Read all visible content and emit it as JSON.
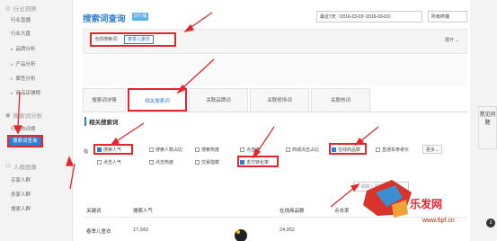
{
  "sidebar": {
    "sections": [
      {
        "label": "行业洞察",
        "items": [
          "行业直播",
          "行业大盘",
          "品牌分析",
          "产品分析",
          "属性分析",
          "商品店铺榜"
        ]
      },
      {
        "label": "搜索词分析",
        "items": [
          "行业热词榜",
          "搜索词查询"
        ]
      },
      {
        "label": "人群画像",
        "items": [
          "买家人群",
          "卖家人群",
          "搜索人群"
        ]
      }
    ]
  },
  "header": {
    "title": "搜索词查询",
    "badge": "日行版",
    "date_range": "最近7天（2016-03-03~2016-03-03）",
    "terminal": "所有终端"
  },
  "keyword": {
    "label": "当前搜索词：",
    "value": "春季儿童衣",
    "expand": "展开"
  },
  "tabs": [
    "搜索词详情",
    "相关搜索词",
    "关联品牌词",
    "关联修饰词",
    "关联热词"
  ],
  "section_title": "相关搜索词",
  "options": {
    "row1": [
      "搜索人气",
      "搜索人数占比",
      "搜索热度",
      "点击率",
      "商城点击占比",
      "在线商品数",
      "直通车参考价"
    ],
    "row2": [
      "点击人气",
      "点击热度",
      "交易指数",
      "支付转化率"
    ],
    "more": "更多",
    "prefix": "指"
  },
  "table_search_placeholder": "请输入关键词",
  "table": {
    "headers": [
      "关键词",
      "搜索人气",
      "在线商品数",
      "点击率"
    ],
    "rows": [
      [
        "春季儿童衣",
        "17,343",
        "24,952",
        ""
      ]
    ]
  },
  "right_tab": "常见问题",
  "watermark": {
    "text": "乐发网",
    "url": "www.6pf.cn"
  },
  "hot_badge": "3"
}
